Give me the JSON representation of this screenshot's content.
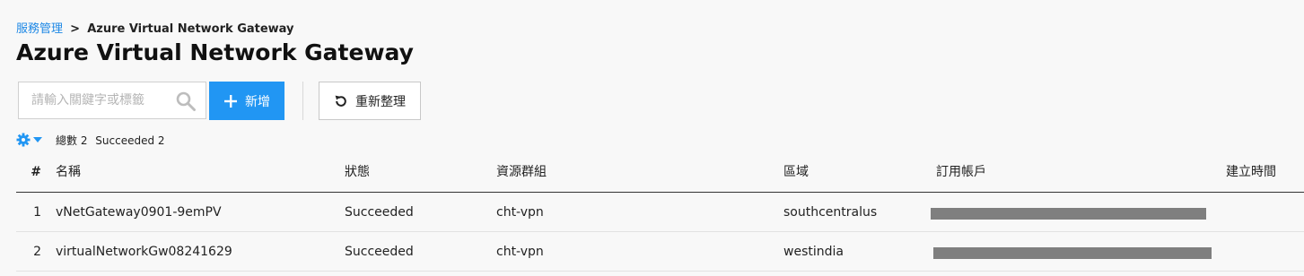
{
  "breadcrumb": {
    "parent": "服務管理",
    "separator": ">",
    "current": "Azure Virtual Network Gateway"
  },
  "page_title": "Azure Virtual Network Gateway",
  "search": {
    "placeholder": "請輸入關鍵字或標籤",
    "value": ""
  },
  "toolbar": {
    "add_label": "新增",
    "refresh_label": "重新整理"
  },
  "summary": {
    "total": "總數 2",
    "succeeded": "Succeeded 2"
  },
  "table": {
    "columns": [
      "#",
      "名稱",
      "狀態",
      "資源群組",
      "區域",
      "訂用帳戶",
      "建立時間"
    ],
    "rows": [
      {
        "num": "1",
        "name": "vNetGateway0901-9emPV",
        "status": "Succeeded",
        "group": "cht-vpn",
        "region": "southcentralus"
      },
      {
        "num": "2",
        "name": "virtualNetworkGw08241629",
        "status": "Succeeded",
        "group": "cht-vpn",
        "region": "westindia"
      }
    ]
  },
  "colors": {
    "accent": "#2196f3",
    "link": "#1e88e5",
    "background": "#f8f8f8",
    "redaction": "#7f7f7f"
  },
  "icons": [
    "search-icon",
    "plus-icon",
    "refresh-icon",
    "gear-icon",
    "caret-down-icon"
  ]
}
